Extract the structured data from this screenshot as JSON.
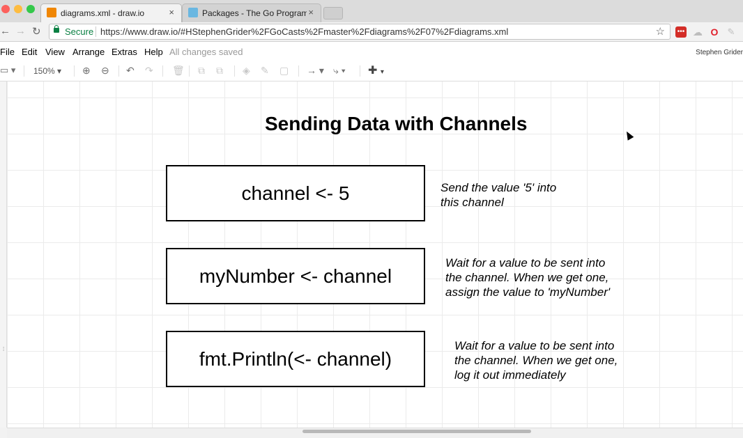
{
  "browser": {
    "tabs": [
      {
        "title": "diagrams.xml - draw.io",
        "close": "×",
        "favicon_color": "#f08705"
      },
      {
        "title": "Packages - The Go Programmi",
        "close": "×",
        "favicon_color": "#6ab7e1"
      }
    ],
    "nav": {
      "back": "←",
      "forward": "→",
      "reload": "↻"
    },
    "address": {
      "secure_label": "Secure",
      "url": "https://www.draw.io/#HStephenGrider%2FGoCasts%2Fmaster%2Fdiagrams%2F07%2Fdiagrams.xml",
      "star": "☆"
    },
    "extensions": [
      {
        "name": "lastpass-icon",
        "color": "#d32d27",
        "glyph": "•••"
      },
      {
        "name": "cloud-icon",
        "color": "#bdbdbd",
        "glyph": "☁"
      },
      {
        "name": "opera-icon",
        "color": "#ffffff",
        "glyph": "O"
      },
      {
        "name": "feather-icon",
        "color": "#ffffff",
        "glyph": "✎"
      }
    ]
  },
  "menubar": {
    "items": [
      "File",
      "Edit",
      "View",
      "Arrange",
      "Extras",
      "Help"
    ],
    "status": "All changes saved",
    "user": "Stephen Grider"
  },
  "toolbar": {
    "zoom": "150%",
    "icons": [
      "format-panel-icon",
      "zoom-in-icon",
      "zoom-out-icon",
      "undo-icon",
      "redo-icon",
      "delete-icon",
      "to-front-icon",
      "to-back-icon",
      "fill-color-icon",
      "line-color-icon",
      "shadow-icon",
      "connection-icon",
      "waypoints-icon",
      "insert-icon"
    ]
  },
  "diagram": {
    "title": "Sending Data with Channels",
    "rows": [
      {
        "code": "channel <- 5",
        "note": [
          "Send the value '5' into",
          "this channel"
        ]
      },
      {
        "code": "myNumber <- channel",
        "note": [
          "Wait for a value to be sent into",
          "the channel.  When we get one,",
          "assign the value to 'myNumber'"
        ]
      },
      {
        "code": "fmt.Println(<- channel)",
        "note": [
          "Wait for a value to be sent into",
          "the channel.  When we get one,",
          "log it out immediately"
        ]
      }
    ]
  }
}
